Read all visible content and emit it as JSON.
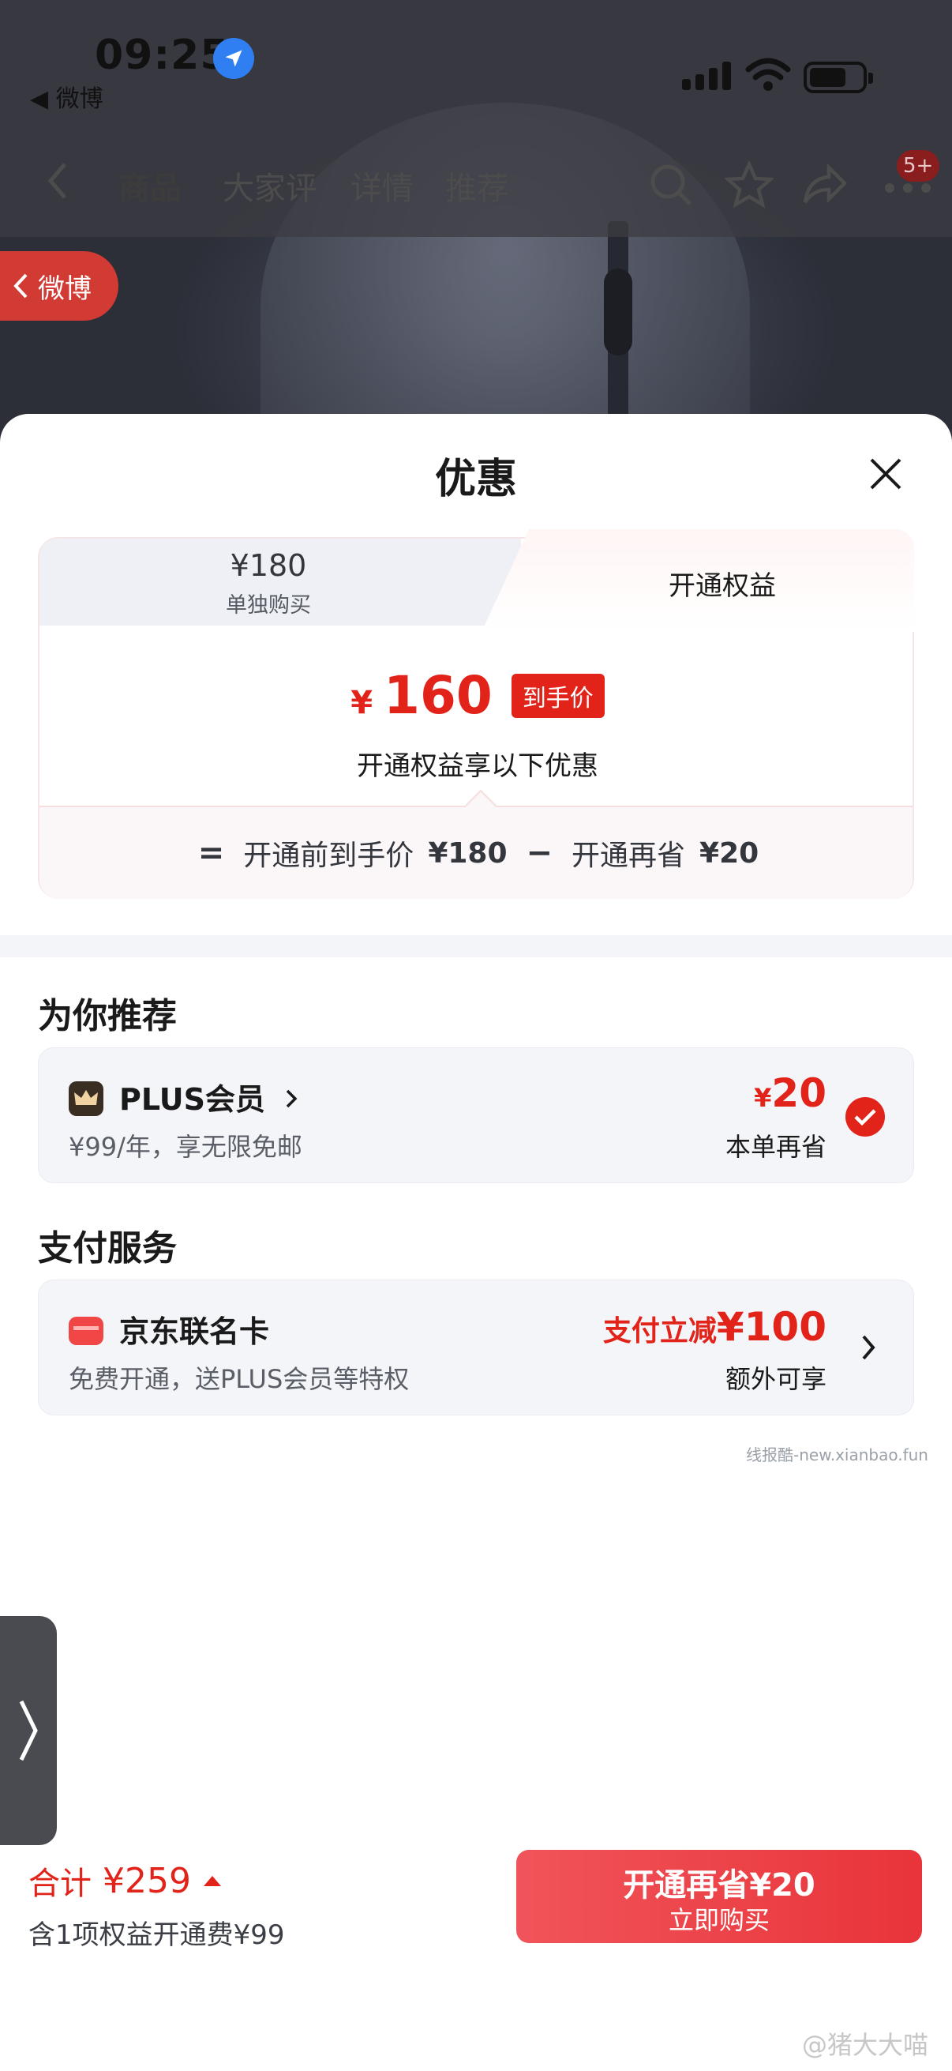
{
  "status_bar": {
    "time": "09:25",
    "back_app": "◀ 微博"
  },
  "product_nav": {
    "tabs": [
      "商品",
      "大家评",
      "详情",
      "推荐"
    ],
    "cart_badge": "5+"
  },
  "weibo_back": {
    "label": "微博"
  },
  "sheet": {
    "title": "优惠",
    "tab_single": {
      "price": "¥180",
      "label": "单独购买"
    },
    "tab_rights": {
      "label": "开通权益"
    },
    "final_price": {
      "currency": "¥",
      "value": "160",
      "tag": "到手价"
    },
    "final_sub": "开通权益享以下优惠",
    "calc": {
      "eq": "=",
      "before_label": "开通前到手价",
      "before_value": "¥180",
      "minus": "−",
      "save_label": "开通再省",
      "save_value": "¥20"
    }
  },
  "recommend": {
    "title": "为你推荐",
    "plus": {
      "name": "PLUS会员",
      "desc": "¥99/年，享无限免邮",
      "save_currency": "¥",
      "save_value": "20",
      "save_label": "本单再省",
      "checked": true
    }
  },
  "payment": {
    "title": "支付服务",
    "card": {
      "name": "京东联名卡",
      "desc": "免费开通，送PLUS会员等特权",
      "offer_prefix": "支付立减",
      "offer_value": "¥100",
      "offer_sub": "额外可享"
    }
  },
  "watermark": "线报酷-new.xianbao.fun",
  "bottom_bar": {
    "total_label": "合计",
    "total_value": "¥259",
    "total_sub": "含1项权益开通费¥99",
    "buy_line1": "开通再省¥20",
    "buy_line2": "立即购买"
  },
  "credit": "@猪大大喵",
  "colors": {
    "accent": "#e2231a",
    "button": "#e8343a",
    "card_bg": "#f4f5f9"
  }
}
